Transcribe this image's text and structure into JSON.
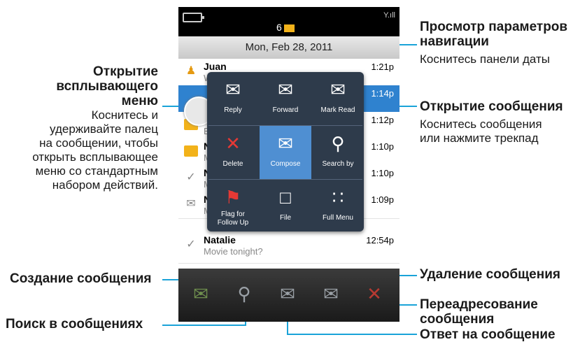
{
  "statusbar": {
    "unread_count": "6"
  },
  "datebar": {
    "label": "Mon, Feb 28, 2011"
  },
  "messages": [
    {
      "from": "Juan",
      "subject": "W",
      "time": "1:21p",
      "icon": "people-icon"
    },
    {
      "from": "",
      "subject": "",
      "time": "1:14p",
      "icon": "",
      "selected": true
    },
    {
      "from": "J",
      "subject": "B",
      "time": "1:12p",
      "icon": "envelope-icon"
    },
    {
      "from": "N",
      "subject": "M",
      "time": "1:10p",
      "icon": "envelope-icon"
    },
    {
      "from": "N",
      "subject": "M",
      "time": "1:10p",
      "icon": "check-icon"
    },
    {
      "from": "N",
      "subject": "M",
      "time": "1:09p",
      "icon": "envelope-open-icon"
    },
    {
      "from": "Natalie",
      "subject": "Movie tonight?",
      "time": "12:54p",
      "icon": "check-icon"
    }
  ],
  "popup": {
    "reply": "Reply",
    "forward": "Forward",
    "mark_read": "Mark Read",
    "delete": "Delete",
    "compose": "Compose",
    "search_by": "Search by",
    "flag_line1": "Flag for",
    "flag_line2": "Follow Up",
    "file": "File",
    "full_menu": "Full Menu"
  },
  "toolbar_icons": [
    "compose-icon",
    "search-icon",
    "reply-icon",
    "forward-icon",
    "delete-icon"
  ],
  "callouts": {
    "nav_title_1": "Просмотр параметров",
    "nav_title_2": "навигации",
    "nav_text": "Коснитесь панели даты",
    "popup_title_1": "Открытие",
    "popup_title_2": "всплывающего",
    "popup_title_3": "меню",
    "popup_text_1": "Коснитесь и",
    "popup_text_2": "удерживайте палец",
    "popup_text_3": "на сообщении, чтобы",
    "popup_text_4": "открыть всплывающее",
    "popup_text_5": "меню со стандартным",
    "popup_text_6": "набором действий.",
    "open_title": "Открытие сообщения",
    "open_text_1": "Коснитесь сообщения",
    "open_text_2": "или нажмите трекпад",
    "create": "Создание сообщения",
    "search": "Поиск в сообщениях",
    "delete": "Удаление сообщения",
    "forward_1": "Переадресование",
    "forward_2": "сообщения",
    "reply": "Ответ на сообщение"
  },
  "colors": {
    "accent": "#1aa3d8",
    "selected_row": "#2f82cf",
    "envelope": "#f2b21a",
    "popup_bg": "#2e3b4b",
    "popup_active": "#4f8fd2"
  }
}
